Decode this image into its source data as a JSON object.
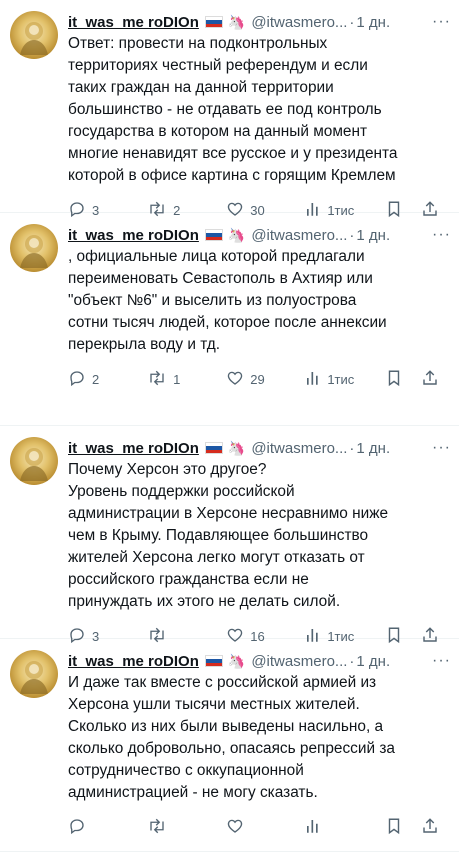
{
  "tweets": [
    {
      "name": "it_was_me roDIOn",
      "handle": "@itwasmero...",
      "time": "1 дн.",
      "lines": [
        "Ответ: провести на подконтрольных",
        "территориях честный референдум и если",
        "таких граждан на данной территории",
        "большинство - не отдавать ее под контроль",
        "государства в котором на данный момент",
        "многие ненавидят все русское и у президента",
        "которой в офисе картина с горящим Кремлем"
      ],
      "replies": "3",
      "retweets": "2",
      "likes": "30",
      "views": "1тис"
    },
    {
      "name": "it_was_me roDIOn",
      "handle": "@itwasmero...",
      "time": "1 дн.",
      "lines": [
        ", официальные лица которой предлагали",
        "переименовать Севастополь в Ахтияр или",
        "\"объект №6\" и выселить из полуострова",
        "сотни тысяч людей, которое после аннексии",
        "перекрыла воду и тд."
      ],
      "replies": "2",
      "retweets": "1",
      "likes": "29",
      "views": "1тис"
    },
    {
      "name": "it_was_me roDIOn",
      "handle": "@itwasmero...",
      "time": "1 дн.",
      "lines": [
        "Почему Херсон это другое?",
        "Уровень поддержки российской",
        "администрации в Херсоне несравнимо ниже",
        "чем в Крыму. Подавляющее большинство",
        "жителей Херсона легко могут отказать от",
        "российского гражданства если не",
        "принуждать их этого не делать силой."
      ],
      "replies": "3",
      "retweets": "",
      "likes": "16",
      "views": "1тис"
    },
    {
      "name": "it_was_me roDIOn",
      "handle": "@itwasmero...",
      "time": "1 дн.",
      "lines": [
        "И даже так вместе с российской армией из",
        "Херсона ушли тысячи местных жителей.",
        "Сколько из них были выведены насильно, а",
        "сколько добровольно, опасаясь репрессий за",
        "сотрудничество с оккупационной",
        "администрацией - не могу сказать."
      ],
      "replies": "",
      "retweets": "",
      "likes": "",
      "views": ""
    }
  ]
}
